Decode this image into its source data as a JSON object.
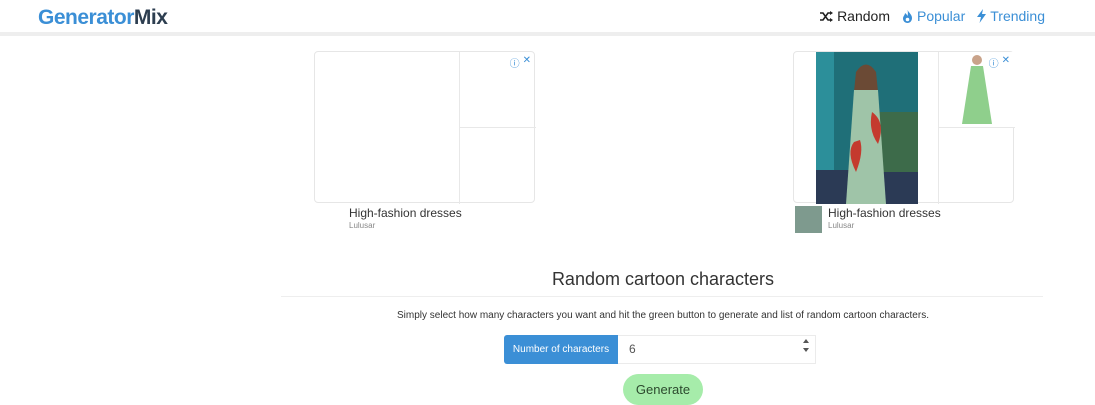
{
  "logo": {
    "part1": "Generator",
    "part2": "Mix"
  },
  "nav": {
    "random": "Random",
    "popular": "Popular",
    "trending": "Trending"
  },
  "ads": [
    {
      "title": "High-fashion dresses",
      "advertiser": "Lulusar"
    },
    {
      "title": "High-fashion dresses",
      "advertiser": "Lulusar"
    }
  ],
  "ad_info": {
    "info": "ⓘ",
    "close": "✕"
  },
  "main": {
    "heading": "Random cartoon characters",
    "description": "Simply select how many characters you want and hit the green button to generate and list of random cartoon characters.",
    "number_label": "Number of characters",
    "number_value": "6",
    "generate_label": "Generate"
  },
  "colors": {
    "accent": "#3b8fd6",
    "generate_bg": "#a6ecaa"
  }
}
